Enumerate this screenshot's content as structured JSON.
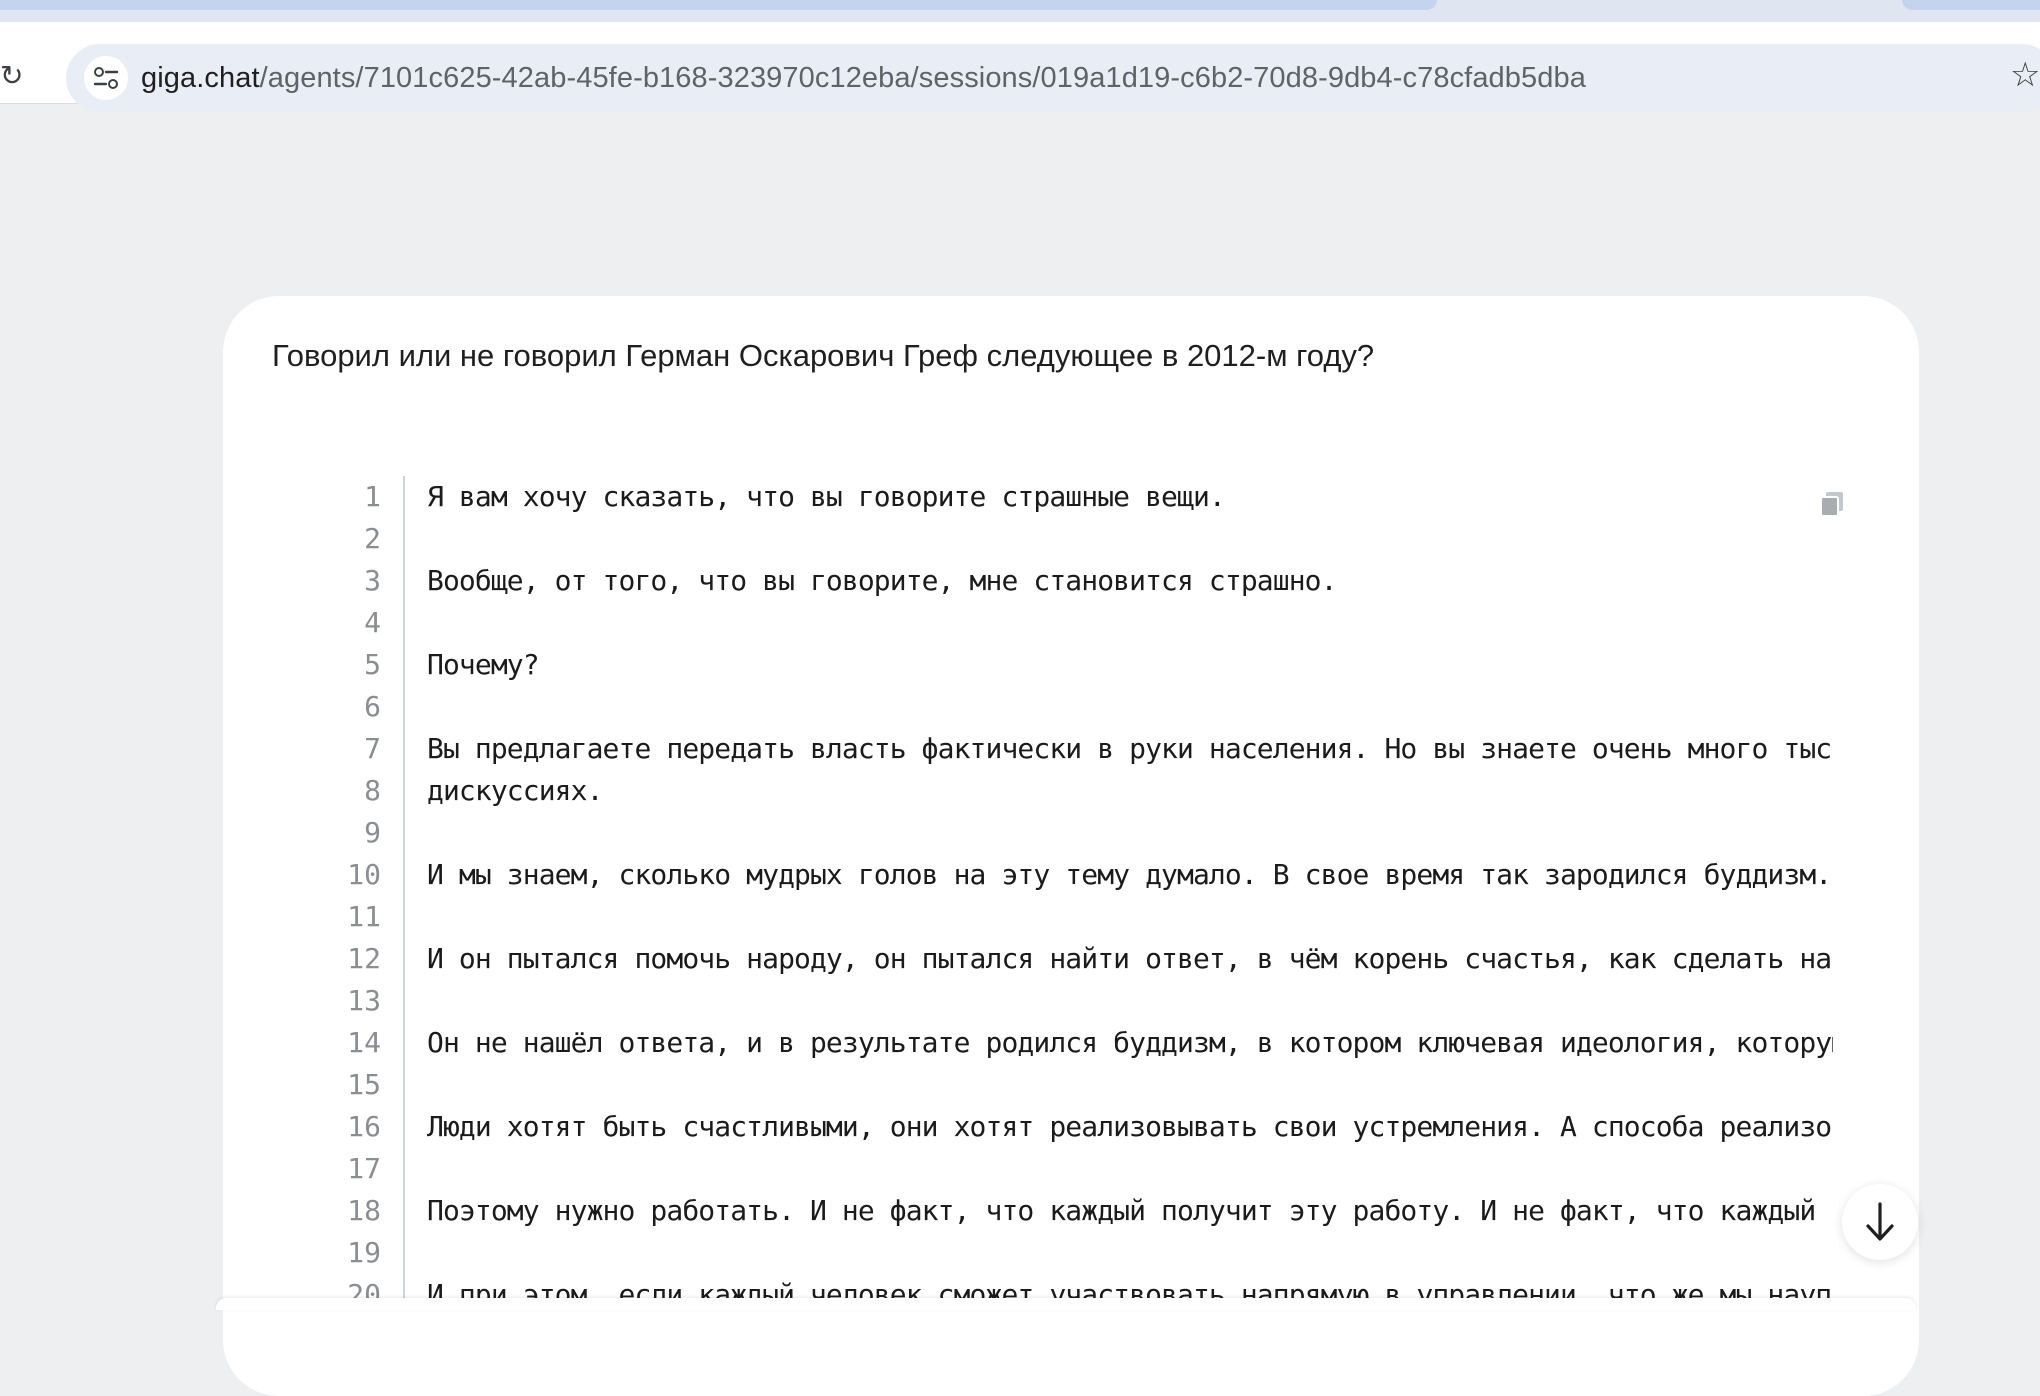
{
  "browser": {
    "url_host": "giga.chat",
    "url_path": "/agents/7101c625-42ab-45fe-b168-323970c12eba/sessions/019a1d19-c6b2-70d8-9db4-c78cfadb5dba",
    "icons": {
      "reload": "reload-icon",
      "site_settings": "tune-icon",
      "bookmark": "star-icon"
    }
  },
  "chat": {
    "question": "Говорил или не говорил Герман Оскарович Греф следующее в 2012-м году?",
    "code_lines": [
      {
        "n": "1",
        "text": "Я вам хочу сказать, что вы говорите страшные вещи."
      },
      {
        "n": "2",
        "text": ""
      },
      {
        "n": "3",
        "text": "Вообще, от того, что вы говорите, мне становится страшно."
      },
      {
        "n": "4",
        "text": ""
      },
      {
        "n": "5",
        "text": "Почему?"
      },
      {
        "n": "6",
        "text": ""
      },
      {
        "n": "7",
        "text": "Вы предлагаете передать власть фактически в руки населения. Но вы знаете очень много тысячеле"
      },
      {
        "n": "8",
        "text": "дискуссиях."
      },
      {
        "n": "9",
        "text": ""
      },
      {
        "n": "10",
        "text": "И мы знаем, сколько мудрых голов на эту тему думало. В свое время так зародился буддизм. Вели"
      },
      {
        "n": "11",
        "text": ""
      },
      {
        "n": "12",
        "text": "И он пытался помочь народу, он пытался найти ответ, в чём корень счастья, как сделать народ"
      },
      {
        "n": "13",
        "text": ""
      },
      {
        "n": "14",
        "text": "Он не нашёл ответа, и в результате родился буддизм, в котором ключевая идеология, которую он"
      },
      {
        "n": "15",
        "text": ""
      },
      {
        "n": "16",
        "text": "Люди хотят быть счастливыми, они хотят реализовывать свои устремления. А способа реализовать"
      },
      {
        "n": "17",
        "text": ""
      },
      {
        "n": "18",
        "text": "Поэтому нужно работать. И не факт, что каждый получит эту работу. И не факт, что каждый пол"
      },
      {
        "n": "19",
        "text": ""
      },
      {
        "n": "20",
        "text": "И при этом, если каждый человек сможет участвовать напрямую в управлении, что же мы науправля"
      }
    ],
    "icons": {
      "copy": "copy-icon",
      "scroll_down": "arrow-down-icon"
    }
  }
}
